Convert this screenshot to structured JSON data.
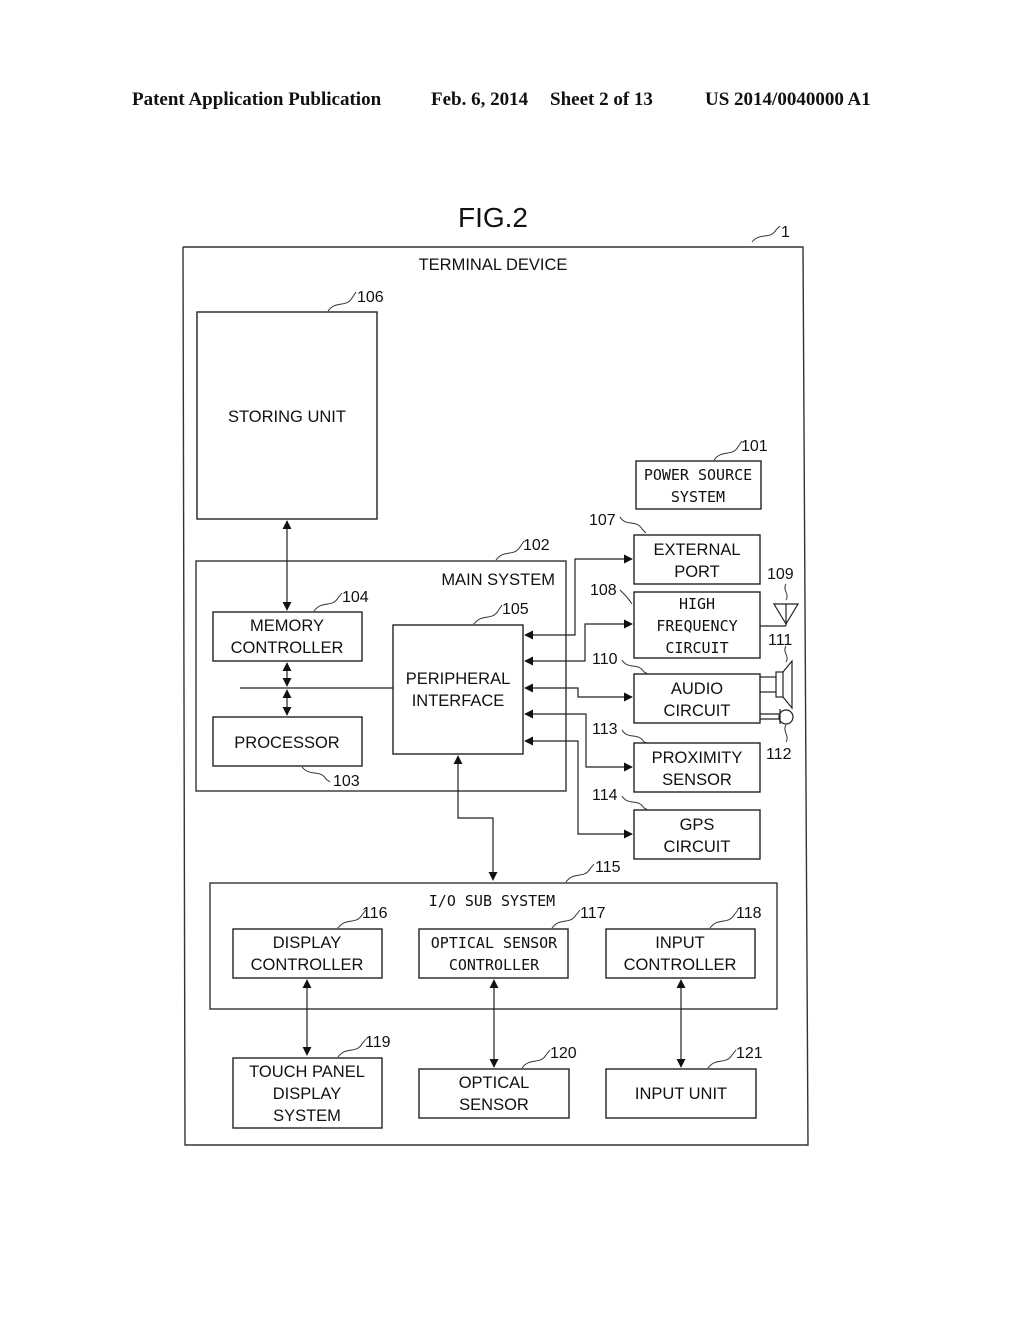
{
  "header": {
    "publication_type": "Patent Application Publication",
    "date": "Feb. 6, 2014",
    "sheet": "Sheet 2 of 13",
    "publication_number": "US 2014/0040000 A1"
  },
  "figure": {
    "title": "FIG.2",
    "device": {
      "label": "TERMINAL DEVICE",
      "ref": "1"
    },
    "storing_unit": {
      "label": "STORING UNIT",
      "ref": "106"
    },
    "power_source": {
      "line1": "POWER SOURCE",
      "line2": "SYSTEM",
      "ref": "101"
    },
    "main_system": {
      "label": "MAIN SYSTEM",
      "ref": "102"
    },
    "memory_controller": {
      "line1": "MEMORY",
      "line2": "CONTROLLER",
      "ref": "104"
    },
    "processor": {
      "label": "PROCESSOR",
      "ref": "103"
    },
    "peripheral_interface": {
      "line1": "PERIPHERAL",
      "line2": "INTERFACE",
      "ref": "105"
    },
    "external_port": {
      "line1": "EXTERNAL",
      "line2": "PORT",
      "ref": "107"
    },
    "high_frequency": {
      "line1": "HIGH",
      "line2": "FREQUENCY",
      "line3": "CIRCUIT",
      "ref": "108"
    },
    "antenna": {
      "ref": "109"
    },
    "audio_circuit": {
      "line1": "AUDIO",
      "line2": "CIRCUIT",
      "ref": "110"
    },
    "speaker": {
      "ref": "111"
    },
    "microphone": {
      "ref": "112"
    },
    "proximity_sensor": {
      "line1": "PROXIMITY",
      "line2": "SENSOR",
      "ref": "113"
    },
    "gps_circuit": {
      "line1": "GPS",
      "line2": "CIRCUIT",
      "ref": "114"
    },
    "io_subsystem": {
      "label": "I/O SUB SYSTEM",
      "ref": "115"
    },
    "display_controller": {
      "line1": "DISPLAY",
      "line2": "CONTROLLER",
      "ref": "116"
    },
    "optical_sensor_controller": {
      "line1": "OPTICAL SENSOR",
      "line2": "CONTROLLER",
      "ref": "117"
    },
    "input_controller": {
      "line1": "INPUT",
      "line2": "CONTROLLER",
      "ref": "118"
    },
    "touch_panel": {
      "line1": "TOUCH PANEL",
      "line2": "DISPLAY",
      "line3": "SYSTEM",
      "ref": "119"
    },
    "optical_sensor": {
      "line1": "OPTICAL",
      "line2": "SENSOR",
      "ref": "120"
    },
    "input_unit": {
      "label": "INPUT UNIT",
      "ref": "121"
    }
  }
}
